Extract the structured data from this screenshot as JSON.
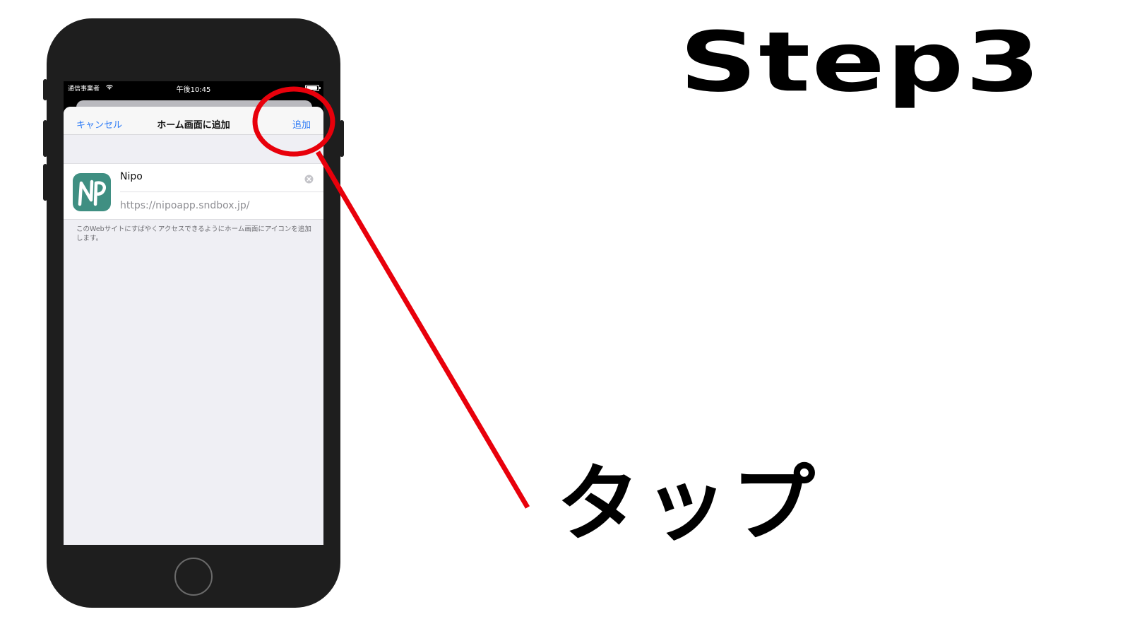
{
  "status_bar": {
    "carrier": "通信事業者",
    "time": "午後10:45"
  },
  "nav": {
    "cancel_label": "キャンセル",
    "title": "ホーム画面に追加",
    "add_label": "追加"
  },
  "bookmark": {
    "icon_letters": "NP",
    "name_value": "Nipo",
    "url": "https://nipoapp.sndbox.jp/"
  },
  "footer_note": "このWebサイトにすばやくアクセスできるようにホーム画面にアイコンを追加します。",
  "annotation": {
    "step_title": "Step3",
    "action_label": "タップ",
    "highlight_color": "#e8000b"
  },
  "colors": {
    "ios_blue": "#2f7cf6",
    "app_icon": "#3f8f82",
    "phone_body": "#1e1e1e"
  },
  "icons": [
    "wifi-icon",
    "battery-icon",
    "clear-icon",
    "app-icon",
    "home-button"
  ]
}
